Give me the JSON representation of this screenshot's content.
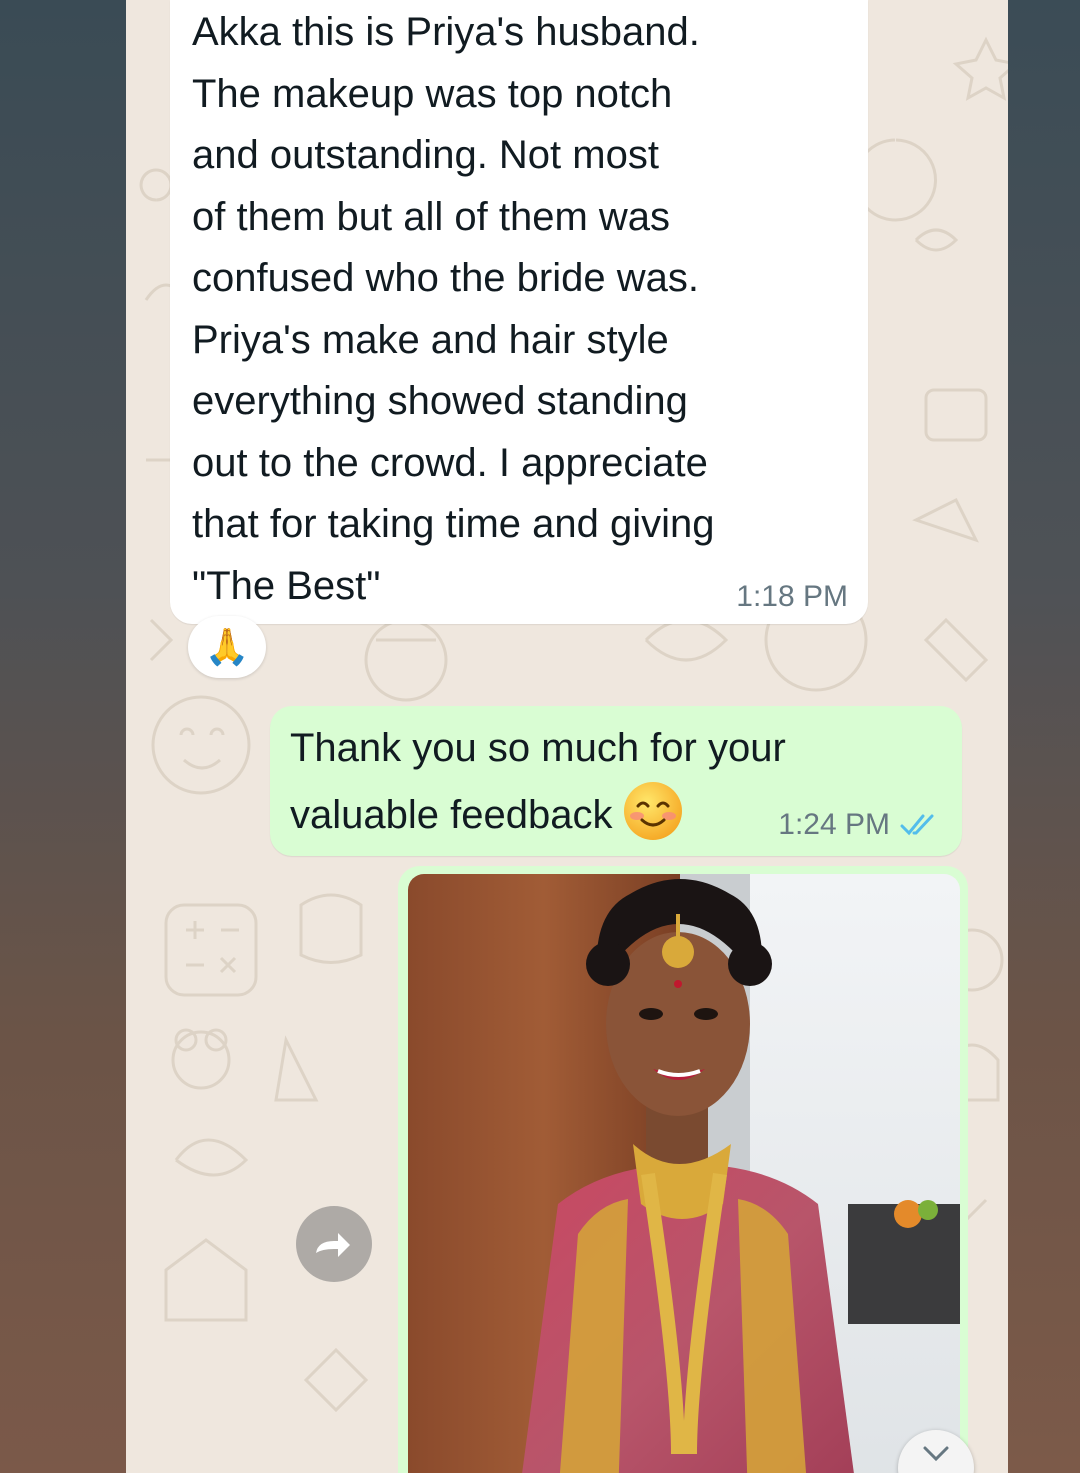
{
  "messages": {
    "incoming": {
      "text": "Akka this is Priya's husband.\nThe makeup was top notch\nand outstanding. Not most\nof them but all of them was\nconfused who the bride was.\nPriya's make and hair style\neverything showed standing\nout to the crowd. I appreciate\nthat for taking time and giving\n\"The Best\"",
      "time": "1:18 PM",
      "reaction": "🙏"
    },
    "outgoing": {
      "text": "Thank you so much for your valuable feedback",
      "emoji": "smiling-face-icon",
      "time": "1:24 PM",
      "status": "read"
    },
    "image": {
      "description_icon": "bride-photo"
    }
  },
  "colors": {
    "chat_background": "#efe7de",
    "incoming_bubble": "#ffffff",
    "outgoing_bubble": "#d9fdd3",
    "timestamp": "#667781",
    "read_ticks": "#53bdeb"
  },
  "icons": {
    "forward": "forward-icon",
    "scroll_down": "chevron-down-icon",
    "read_receipt": "double-check-icon"
  }
}
